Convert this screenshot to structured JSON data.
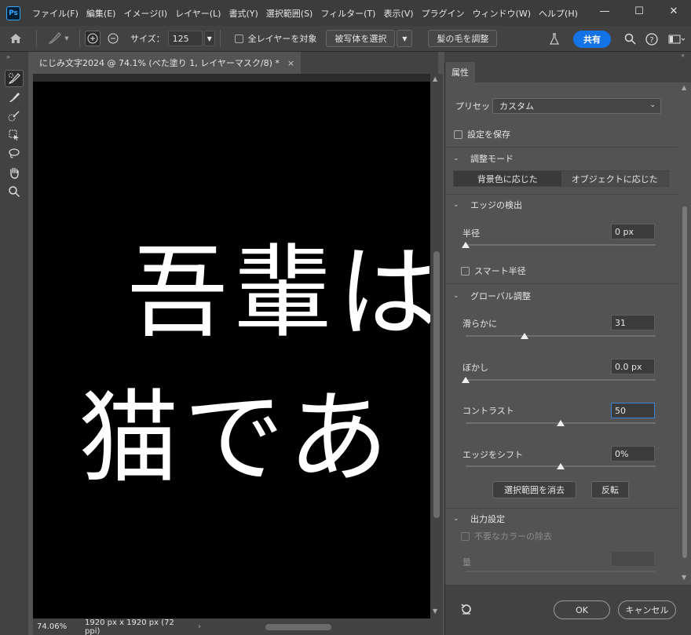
{
  "app": {
    "logo": "Ps"
  },
  "menubar": {
    "items": [
      "ファイル(F)",
      "編集(E)",
      "イメージ(I)",
      "レイヤー(L)",
      "書式(Y)",
      "選択範囲(S)",
      "フィルター(T)",
      "表示(V)",
      "プラグイン",
      "ウィンドウ(W)",
      "ヘルプ(H)"
    ]
  },
  "window_controls": {
    "minimize": "—",
    "maximize": "☐",
    "close": "✕"
  },
  "optbar": {
    "size_label": "サイズ：",
    "size_value": "125",
    "all_layers_label": "全レイヤーを対象",
    "select_subject_label": "被写体を選択",
    "refine_hair_label": "髪の毛を調整",
    "share_label": "共有"
  },
  "document": {
    "tab_title": "にじみ文字2024 @ 74.1% (べた塗り 1, レイヤーマスク/8) *",
    "tab_close": "×",
    "canvas_line1": "吾輩は",
    "canvas_line2": "猫であ",
    "zoom": "74.06%",
    "dimensions": "1920 px x 1920 px (72 ppi)",
    "status_arrow": "›"
  },
  "properties": {
    "tab": "属性",
    "preset_label": "プリセット",
    "preset_value": "カスタム",
    "save_settings_label": "設定を保存",
    "adjust_mode": {
      "title": "調整モード",
      "options": [
        "背景色に応じた",
        "オブジェクトに応じた"
      ],
      "selected": 0
    },
    "edge_detection": {
      "title": "エッジの検出",
      "radius_label": "半径",
      "radius_value": "0 px",
      "radius_level": 0,
      "smart_radius_label": "スマート半径"
    },
    "global_refine": {
      "title": "グローバル調整",
      "smooth_label": "滑らかに",
      "smooth_value": "31",
      "smooth_level": 0.31,
      "feather_label": "ぼかし",
      "feather_value": "0.0 px",
      "feather_level": 0,
      "contrast_label": "コントラスト",
      "contrast_value": "50",
      "contrast_level": 0.5,
      "shift_edge_label": "エッジをシフト",
      "shift_edge_value": "0%",
      "shift_edge_level": 0.5,
      "clear_selection_label": "選択範囲を消去",
      "invert_label": "反転"
    },
    "output": {
      "title": "出力設定",
      "decontaminate_label": "不要なカラーの除去",
      "amount_label": "量"
    },
    "ok_label": "OK",
    "cancel_label": "キャンセル"
  }
}
